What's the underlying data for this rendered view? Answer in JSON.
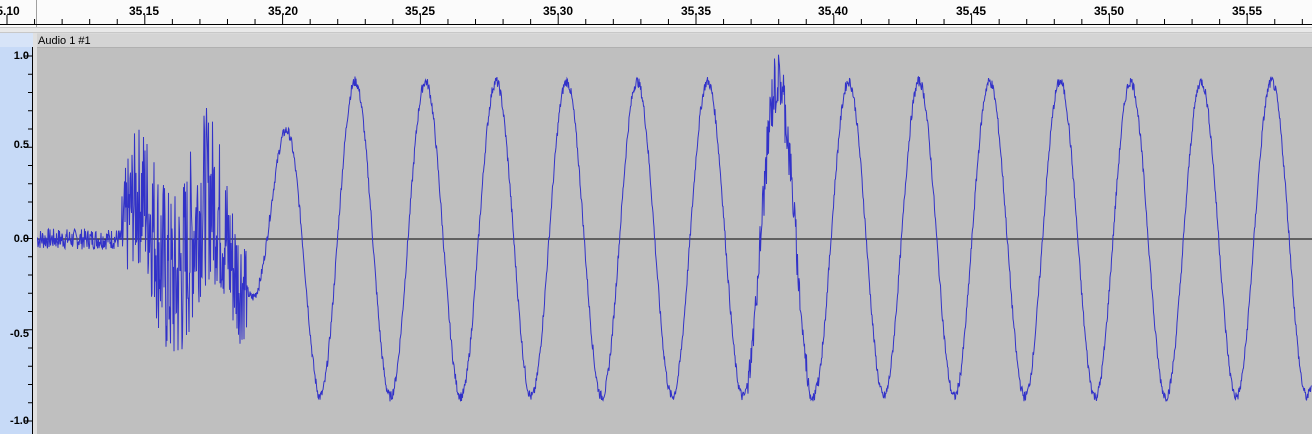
{
  "timeline": {
    "tick_labels": [
      "5.10",
      "35.15",
      "35.20",
      "35.25",
      "35.30",
      "35.35",
      "35.40",
      "35.45",
      "35.50",
      "35.55"
    ]
  },
  "track": {
    "clip_name": "Audio 1 #1",
    "amplitude_labels": [
      "1.0",
      "0.5",
      "0.0",
      "-0.5",
      "-1.0"
    ]
  },
  "colors": {
    "waveform": "#3232c8",
    "background": "#bfbfbf",
    "ruler": "#c7daf7"
  }
}
